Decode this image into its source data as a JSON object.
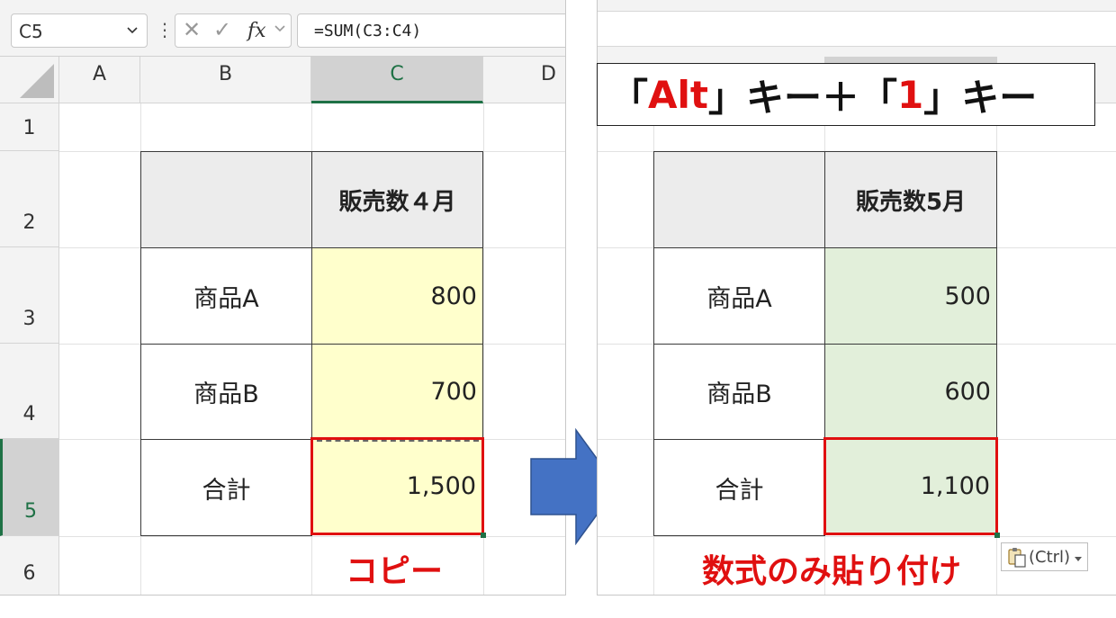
{
  "left": {
    "name_box": "C5",
    "formula": "=SUM(C3:C4)",
    "columns": [
      "A",
      "B",
      "C",
      "D"
    ],
    "rows": [
      "1",
      "2",
      "3",
      "4",
      "5",
      "6"
    ],
    "table": {
      "header": "販売数４月",
      "rows": [
        {
          "label": "商品A",
          "value": "800"
        },
        {
          "label": "商品B",
          "value": "700"
        },
        {
          "label": "合計",
          "value": "1,500"
        }
      ]
    },
    "caption": "コピー"
  },
  "right": {
    "key_banner": {
      "p1": "「",
      "k1": "Alt",
      "p2": "」キー＋「",
      "k2": "1",
      "p3": "」キー"
    },
    "table": {
      "header": "販売数5月",
      "rows": [
        {
          "label": "商品A",
          "value": "500"
        },
        {
          "label": "商品B",
          "value": "600"
        },
        {
          "label": "合計",
          "value": "1,100"
        }
      ]
    },
    "caption": "数式のみ貼り付け",
    "paste_options": "(Ctrl)"
  },
  "colors": {
    "accent_green": "#1e7145",
    "highlight_red": "#e01010",
    "arrow_blue": "#4472c4",
    "copy_fill": "#ffffcc",
    "paste_fill": "#e2efda"
  }
}
